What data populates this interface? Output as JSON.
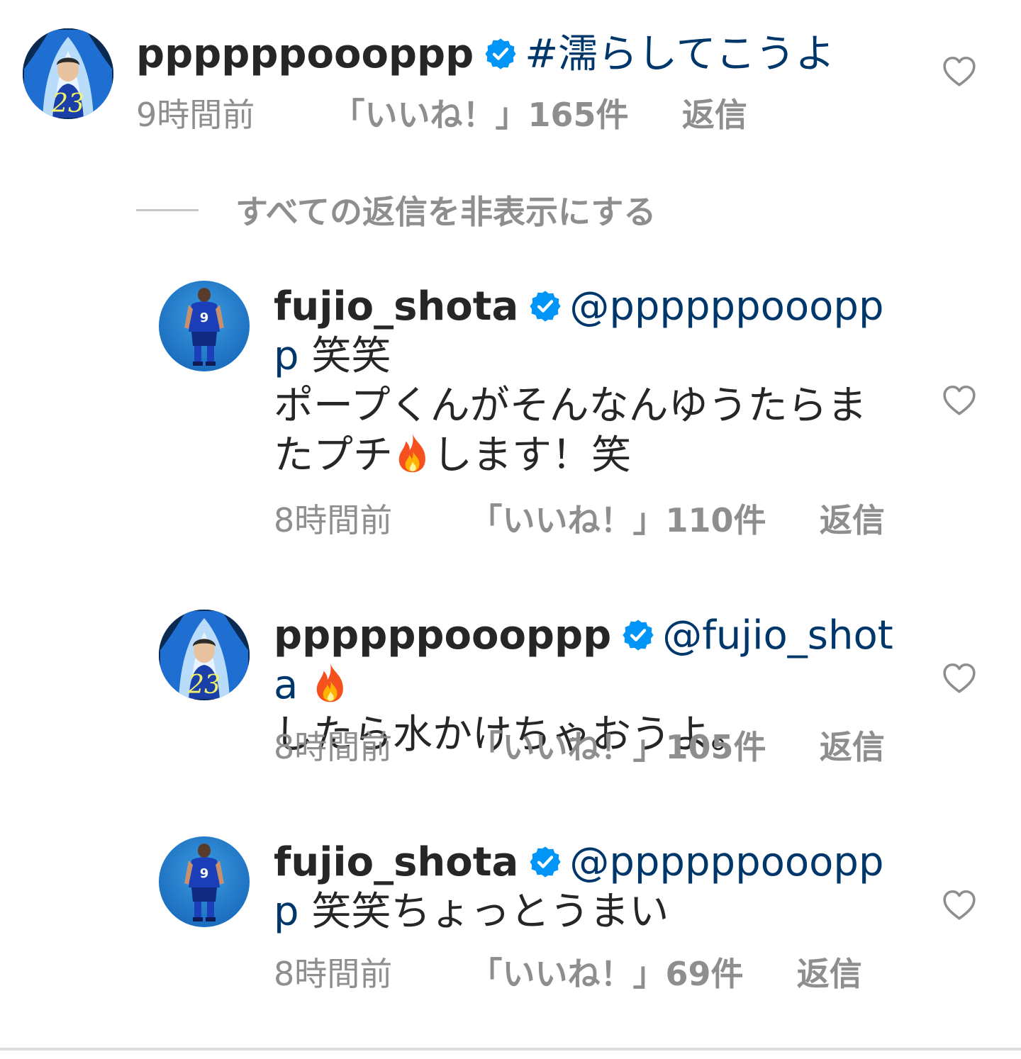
{
  "comments": [
    {
      "username": "ppppppoooppp",
      "text_link": "#濡らしてこうよ",
      "text": "",
      "time": "9時間前",
      "likes": "「いいね！」165件",
      "reply": "返信"
    },
    {
      "username": "fujio_shota",
      "text_link": "@ppppppoooppp",
      "text_a": " 笑笑",
      "text_b": "ポープくんがそんなんゆうたらまたプチ",
      "text_c": "します！笑",
      "time": "8時間前",
      "likes": "「いいね！」110件",
      "reply": "返信"
    },
    {
      "username": "ppppppoooppp",
      "text_link": "@fujio_shota",
      "text_a": "したら水かけちゃおうよ。",
      "time": "8時間前",
      "likes": "「いいね！」105件",
      "reply": "返信"
    },
    {
      "username": "fujio_shota",
      "text_link": "@ppppppoooppp",
      "text_a": " 笑笑ちょっとうまい",
      "time": "8時間前",
      "likes": "「いいね！」69件",
      "reply": "返信"
    }
  ],
  "hide_replies_label": "すべての返信を非表示にする",
  "colors": {
    "verified": "#0095f6",
    "link": "#00376b",
    "meta": "#8e8e8e"
  },
  "icons": [
    "verified-badge-icon",
    "heart-icon",
    "fire-emoji-icon",
    "avatar"
  ]
}
